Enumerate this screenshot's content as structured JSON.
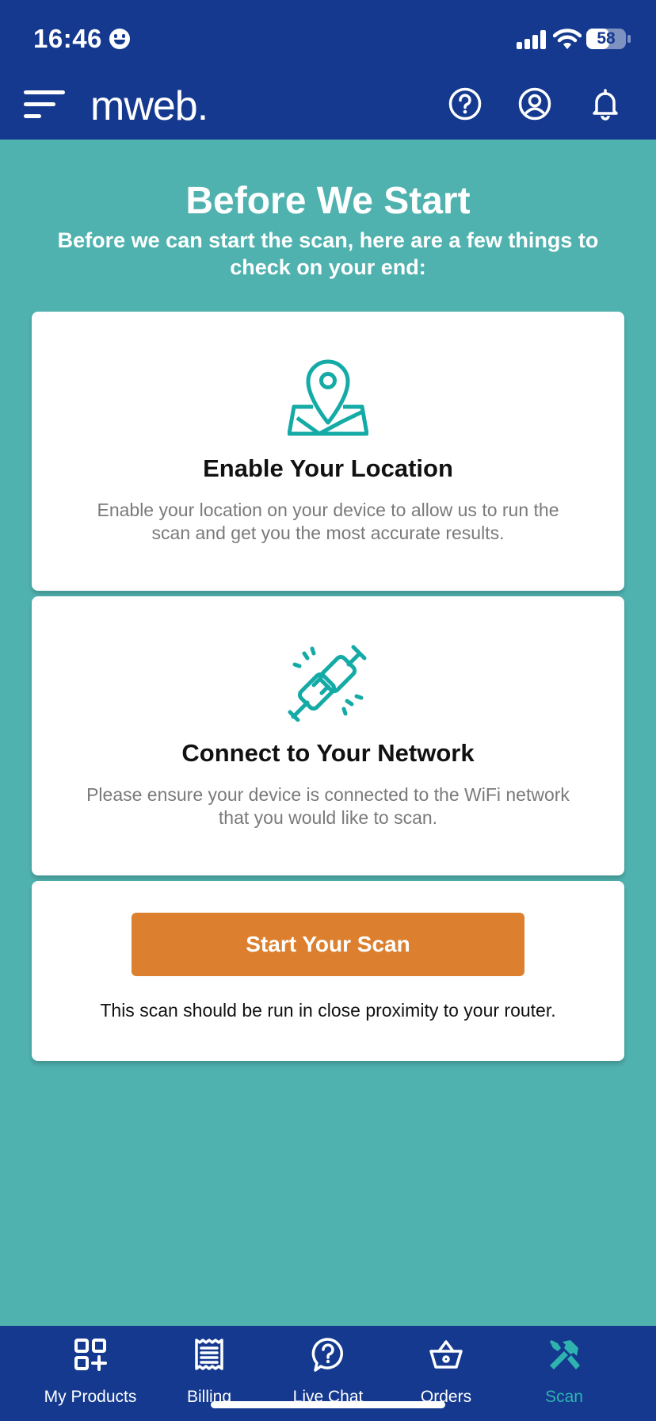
{
  "status_bar": {
    "time": "16:46",
    "battery": "58",
    "battery_level": 0.58
  },
  "header": {
    "logo": "mweb.",
    "icons": [
      "menu-icon",
      "help-icon",
      "account-icon",
      "notification-bell-icon"
    ]
  },
  "colors": {
    "header_bg": "#14398f",
    "page_bg": "#50b2af",
    "accent_teal": "#14aaa6",
    "button_orange": "#dc7f2e"
  },
  "main": {
    "title": "Before We Start",
    "subtitle": "Before we can start the scan, here are a few things to check on your end:",
    "cards": [
      {
        "icon": "map-pin-icon",
        "title": "Enable Your Location",
        "text": "Enable your location on your device to allow us to run the scan and get you the most accurate results."
      },
      {
        "icon": "plug-connect-icon",
        "title": "Connect to Your Network",
        "text": "Please ensure your device is connected to the WiFi network that you would like to scan."
      }
    ],
    "scan_button_label": "Start Your Scan",
    "scan_note": "This scan should be run in close proximity to your router."
  },
  "bottom_nav": {
    "items": [
      {
        "label": "My Products",
        "icon": "products-grid-icon"
      },
      {
        "label": "Billing",
        "icon": "receipt-icon"
      },
      {
        "label": "Live Chat",
        "icon": "chat-help-icon"
      },
      {
        "label": "Orders",
        "icon": "basket-icon"
      },
      {
        "label": "Scan",
        "icon": "tools-icon",
        "active": true
      }
    ]
  }
}
